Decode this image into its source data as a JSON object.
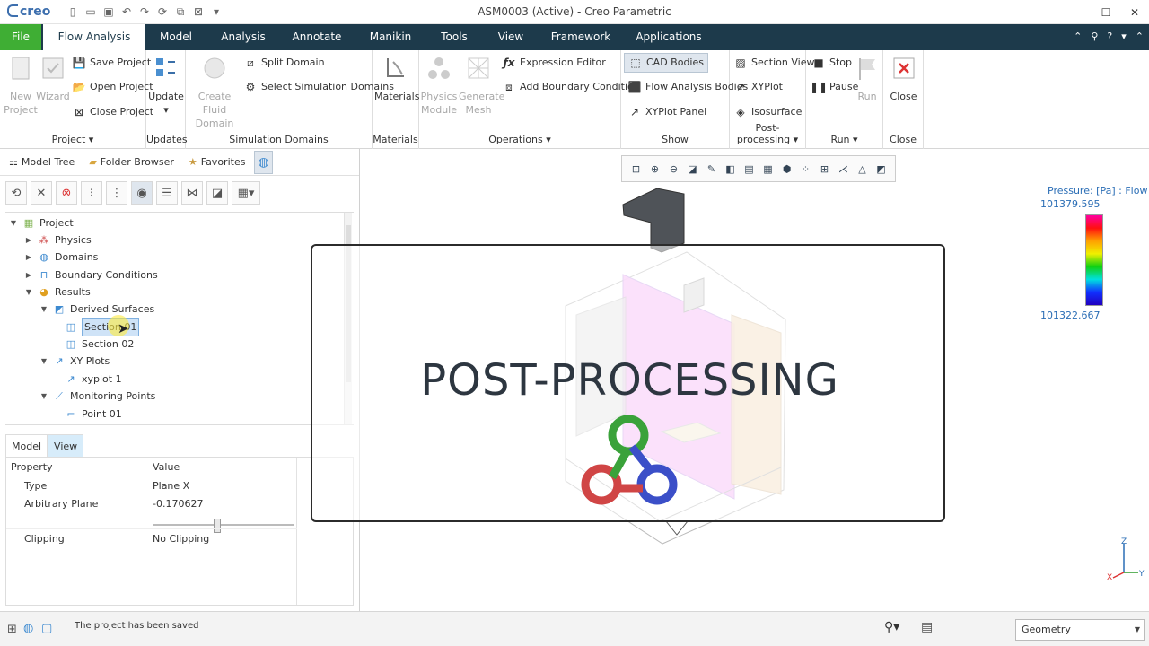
{
  "titlebar": {
    "logo": "creo",
    "title": "ASM0003 (Active) - Creo Parametric"
  },
  "tabs": [
    "File",
    "Flow Analysis",
    "Model",
    "Analysis",
    "Annotate",
    "Manikin",
    "Tools",
    "View",
    "Framework",
    "Applications"
  ],
  "ribbon": {
    "project": {
      "new": "New Project",
      "wizard": "Wizard",
      "save": "Save Project",
      "open": "Open Project",
      "close": "Close Project",
      "label": "Project"
    },
    "updates": {
      "update": "Update",
      "label": "Updates"
    },
    "sim": {
      "create": "Create Fluid Domain",
      "split": "Split Domain",
      "select": "Select Simulation Domains",
      "label": "Simulation Domains"
    },
    "materials": {
      "btn": "Materials",
      "label": "Materials"
    },
    "operations": {
      "physics": "Physics Module",
      "mesh": "Generate Mesh",
      "expr": "Expression Editor",
      "boundary": "Add Boundary Condition",
      "label": "Operations"
    },
    "show": {
      "cad": "CAD Bodies",
      "flow": "Flow Analysis Bodies",
      "xyp": "XYPlot Panel",
      "label": "Show"
    },
    "post": {
      "section": "Section View",
      "xyplot": "XYPlot",
      "iso": "Isosurface",
      "label": "Post-processing"
    },
    "run": {
      "stop": "Stop",
      "pause": "Pause",
      "run": "Run",
      "label": "Run"
    },
    "close": {
      "btn": "Close",
      "label": "Close"
    }
  },
  "navtabs": [
    "Model Tree",
    "Folder Browser",
    "Favorites"
  ],
  "tree": {
    "project": "Project",
    "physics": "Physics",
    "domains": "Domains",
    "boundary": "Boundary Conditions",
    "results": "Results",
    "derived": "Derived Surfaces",
    "section1": "Section 01",
    "section2": "Section 02",
    "xyplots": "XY Plots",
    "xyplot1": "xyplot 1",
    "monitoring": "Monitoring Points",
    "point1": "Point 01"
  },
  "ptabs": [
    "Model",
    "View"
  ],
  "props": {
    "h_property": "Property",
    "h_value": "Value",
    "type_label": "Type",
    "type_value": "Plane X",
    "plane_label": "Arbitrary Plane",
    "plane_value": "-0.170627",
    "slider": 0.45,
    "clip_label": "Clipping",
    "clip_value": "No Clipping"
  },
  "legend": {
    "title": "Pressure: [Pa] : Flow",
    "max": "101379.595",
    "min": "101322.667"
  },
  "overlay": {
    "title": "POST-PROCESSING"
  },
  "status": {
    "message": "The project has been saved",
    "filter": "Geometry"
  }
}
